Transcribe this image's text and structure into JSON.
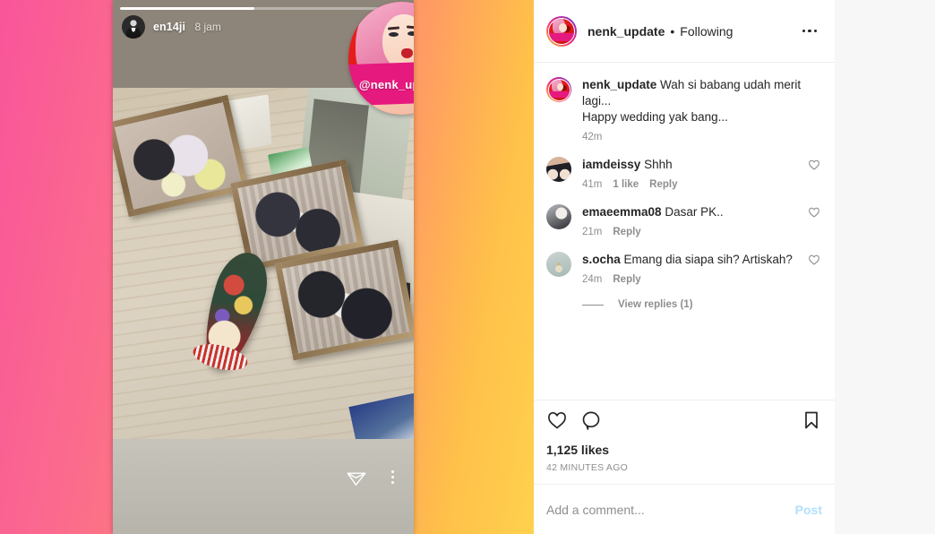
{
  "story": {
    "progress_percent": 47,
    "username": "en14ji",
    "time": "8 jam",
    "sticker_handle": "@nenk_update",
    "send_icon": "paper-plane-icon",
    "more_icon": "kebab-vertical-icon"
  },
  "post": {
    "header": {
      "username": "nenk_update",
      "separator": "•",
      "relationship": "Following",
      "more_icon": "kebab-horizontal-icon"
    },
    "caption": {
      "username": "nenk_update",
      "text": "Wah si babang udah merit lagi...\nHappy wedding yak bang...",
      "time": "42m"
    },
    "comments": [
      {
        "username": "iamdeissy",
        "text": "Shhh",
        "time": "41m",
        "likes": "1 like",
        "reply": "Reply",
        "like_icon": "heart-outline-icon"
      },
      {
        "username": "emaeemma08",
        "text": "Dasar PK..",
        "time": "21m",
        "likes": "",
        "reply": "Reply",
        "like_icon": "heart-outline-icon"
      },
      {
        "username": "s.ocha",
        "text": "Emang dia siapa sih? Artiskah?",
        "time": "24m",
        "likes": "",
        "reply": "Reply",
        "like_icon": "heart-outline-icon"
      }
    ],
    "view_replies": "View replies (1)",
    "actions": {
      "like_icon": "heart-outline-icon",
      "comment_icon": "speech-bubble-icon",
      "save_icon": "bookmark-outline-icon"
    },
    "likes": "1,125 likes",
    "timeago": "42 MINUTES AGO",
    "add_comment_placeholder": "Add a comment...",
    "post_label": "Post"
  },
  "colors": {
    "accent_pink": "#e6197e",
    "ig_text": "#262626",
    "ig_muted": "#8e8e8e",
    "post_blue": "#b2dffc"
  }
}
